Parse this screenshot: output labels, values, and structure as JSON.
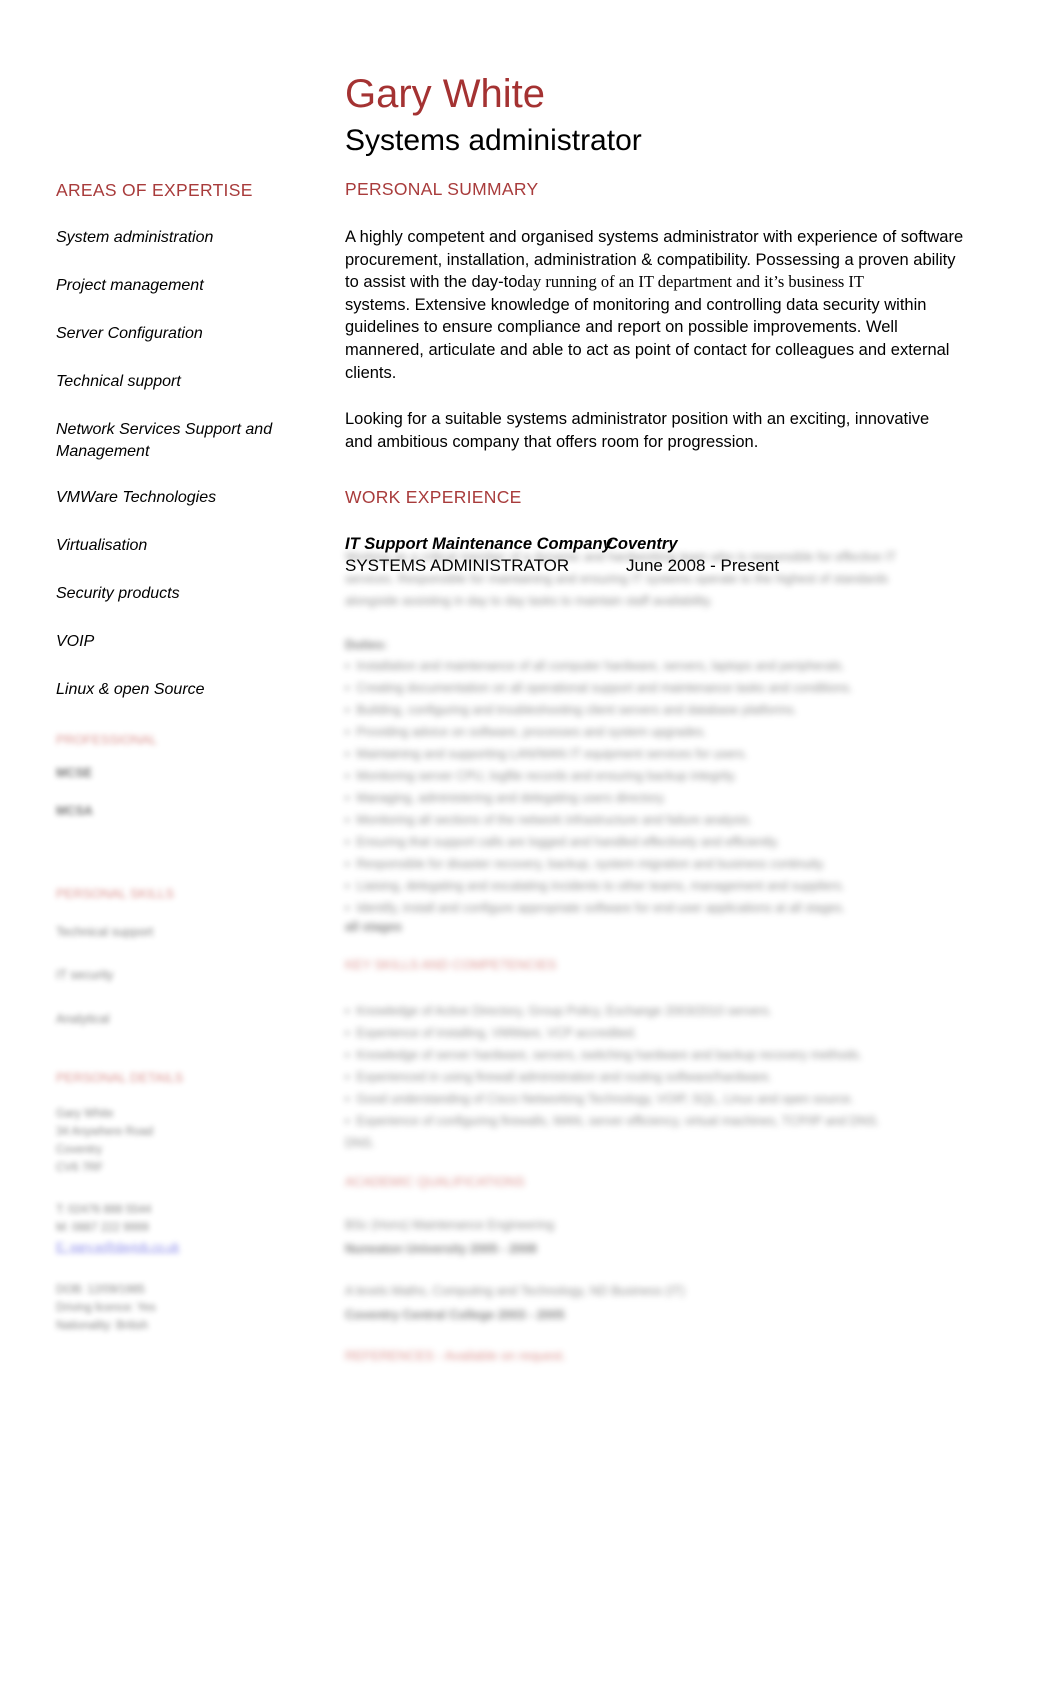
{
  "header": {
    "name": "Gary White",
    "title": "Systems administrator"
  },
  "sidebar": {
    "expertise_heading": "AREAS OF EXPERTISE",
    "expertise": [
      "System administration",
      "Project management",
      "Server Configuration",
      "Technical support",
      "Network Services Support and Management",
      "VMWare Technologies",
      "Virtualisation",
      "Security products",
      "VOIP",
      "Linux & open Source"
    ],
    "redacted_sections": [
      {
        "heading": "PROFESSIONAL",
        "lines": [
          "MCSE",
          "MCSA"
        ]
      },
      {
        "heading": "PERSONAL SKILLS",
        "lines": [
          "Technical support",
          "IT security",
          "Analytical"
        ]
      },
      {
        "heading": "PERSONAL DETAILS",
        "lines": [
          "Gary White",
          "34 Anywhere Road",
          "Coventry",
          "CV6 7RF",
          "",
          "T: 02476 888 5544",
          "M: 0887 222 9999",
          "E: gary.w@dayjob.co.uk",
          "",
          "DOB: 12/09/1985",
          "Driving licence: Yes",
          "Nationality: British"
        ]
      }
    ]
  },
  "main": {
    "summary_heading": "PERSONAL SUMMARY",
    "summary_paragraph_1_parts": [
      {
        "text": "A highly competent and organised systems administrator with experience of software",
        "serif": false
      },
      {
        "text": "procurement, installation, administration & compatibility. Possessing a proven ability",
        "serif": false
      },
      {
        "text": "to assist with the day-to",
        "serif": false
      },
      {
        "text": "day running of an IT department and it’s business IT",
        "serif": true
      },
      {
        "text": "systems. Extensive knowledge of monitoring and controlling data security within",
        "serif": false
      },
      {
        "text": "guidelines to ensure compliance and report on possible improvements. Well",
        "serif": false
      },
      {
        "text": "mannered, articulate and able to act as point of contact for colleagues and external",
        "serif": false
      },
      {
        "text": "clients.",
        "serif": false
      }
    ],
    "summary_paragraph_2": [
      "Looking for a suitable systems administrator position with an exciting, innovative",
      "and ambitious company that offers room for progression."
    ],
    "work_heading": "WORK EXPERIENCE",
    "experience": {
      "company": "IT Support Maintenance Company",
      "location": "Coventry",
      "role": "SYSTEMS ADMINISTRATOR",
      "dates": "June 2008 - Present"
    },
    "redacted_blocks": [
      {
        "type": "paragraph",
        "lines": [
          "Working as a critical member of a dynamic and hardworking team who is responsible for effective IT",
          "services. Responsible for maintaining and ensuring IT systems operate to the highest of standards",
          "alongside assisting in day to day tasks to maintain staff availability."
        ]
      },
      {
        "type": "label",
        "text": "Duties:"
      },
      {
        "type": "bullets",
        "items": [
          "Installation and maintenance of all computer hardware, servers, laptops and peripherals.",
          "Creating documentation on all operational support and maintenance tasks and conditions.",
          "Building, configuring and troubleshooting client servers and database platforms.",
          "Providing advice on software, processes and system upgrades.",
          "Maintaining and supporting LAN/WAN IT equipment services for users.",
          "Monitoring server CPU, logfile records and ensuring backup integrity.",
          "Managing, administering and delegating users directory.",
          "Monitoring all sections of the network infrastructure and failure analysis.",
          "Ensuring that support calls are logged and handled effectively and efficiently.",
          "Responsible for disaster recovery, backup, system migration and business continuity.",
          "Liaising, delegating and escalating incidents to other teams, management and suppliers.",
          "Identify, install and configure appropriate software for end-user applications at all stages."
        ]
      },
      {
        "type": "heading",
        "text": "KEY SKILLS AND COMPETENCIES"
      },
      {
        "type": "bullets",
        "items": [
          "Knowledge of Active Directory, Group Policy, Exchange 2003/2010 servers.",
          "Experience of installing, VMWare, VCP accredited.",
          "Knowledge of server hardware, servers, switching hardware and backup recovery methods.",
          "Experienced in using firewall administration and routing software/hardware.",
          "Good understanding of Cisco Networking Technology, VOIP, SQL, Linux and open source.",
          "Experience of configuring firewalls, WAN, server efficiency, virtual machines, TCP/IP and DNS."
        ]
      },
      {
        "type": "heading",
        "text": "ACADEMIC QUALIFICATIONS"
      },
      {
        "type": "edu",
        "lines": [
          "BSc (Hons)          Maintenance Engineering",
          "Nuneaton University        2005 - 2008",
          "",
          "A levels          Maths, Computing and Technology, ND Business (IT)",
          "Coventry Central College        2003 - 2005"
        ]
      },
      {
        "type": "heading",
        "text": "REFERENCES - Available on request."
      }
    ]
  },
  "colors": {
    "accent_red": "#a83b3b",
    "name_red": "#a43232",
    "link_blue": "#4a4ae0",
    "body_black": "#000000"
  }
}
